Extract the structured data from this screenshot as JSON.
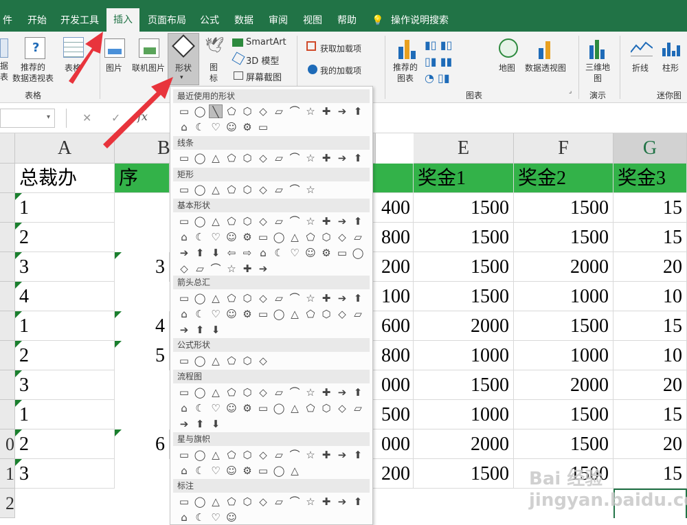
{
  "tabs": [
    "件",
    "开始",
    "开发工具",
    "插入",
    "页面布局",
    "公式",
    "数据",
    "审阅",
    "视图",
    "帮助",
    "操作说明搜索"
  ],
  "active_tab": "插入",
  "ribbon": {
    "pivot_partial": "据\n表",
    "recommended_pivot": "推荐的\n数据透视表",
    "table": "表格",
    "picture": "图片",
    "online_picture": "联机图片",
    "shapes": "形状",
    "icons": "图\n标",
    "smartart": "SmartArt",
    "model3d": "3D 模型",
    "screenshot": "屏幕截图",
    "get_addins": "获取加载项",
    "my_addins": "我的加载项",
    "recommended_charts": "推荐的\n图表",
    "maps": "地图",
    "pivot_chart": "数据透视图",
    "map3d": "三维地\n图",
    "line": "折线",
    "column": "柱形",
    "group_tables": "表格",
    "group_charts": "图表",
    "group_tours": "演示",
    "group_sparklines": "迷你图"
  },
  "formula_bar": {
    "fx": "fx"
  },
  "columns": [
    "A",
    "B",
    "E",
    "F",
    "G"
  ],
  "rows": [
    "",
    "",
    "",
    "",
    "",
    "",
    "",
    "",
    "",
    "0",
    "1",
    "2"
  ],
  "col_a": [
    "总裁办",
    "1",
    "2",
    "3",
    "4",
    "1",
    "2",
    "3",
    "1",
    "2",
    "3"
  ],
  "col_b_header": "序",
  "col_b_vals": [
    "3",
    "4",
    "5",
    "6"
  ],
  "col_d": [
    "400",
    "800",
    "200",
    "100",
    "600",
    "800",
    "000",
    "500",
    "000",
    "200"
  ],
  "col_e": [
    "奖金1",
    "1500",
    "1500",
    "1500",
    "1500",
    "2000",
    "1000",
    "1500",
    "1000",
    "2000",
    "1500"
  ],
  "col_f": [
    "奖金2",
    "1500",
    "1500",
    "2000",
    "1000",
    "1500",
    "1000",
    "2000",
    "1500",
    "1500",
    "1500"
  ],
  "col_g": [
    "奖金3",
    "15",
    "15",
    "20",
    "10",
    "15",
    "10",
    "20",
    "15",
    "20",
    "15"
  ],
  "menu": {
    "recent": "最近使用的形状",
    "lines": "线条",
    "rect": "矩形",
    "basic": "基本形状",
    "arrows": "箭头总汇",
    "equation": "公式形状",
    "flowchart": "流程图",
    "stars": "星与旗帜",
    "callouts": "标注"
  },
  "watermark": "Bai 经验 jingyan.baidu.com"
}
